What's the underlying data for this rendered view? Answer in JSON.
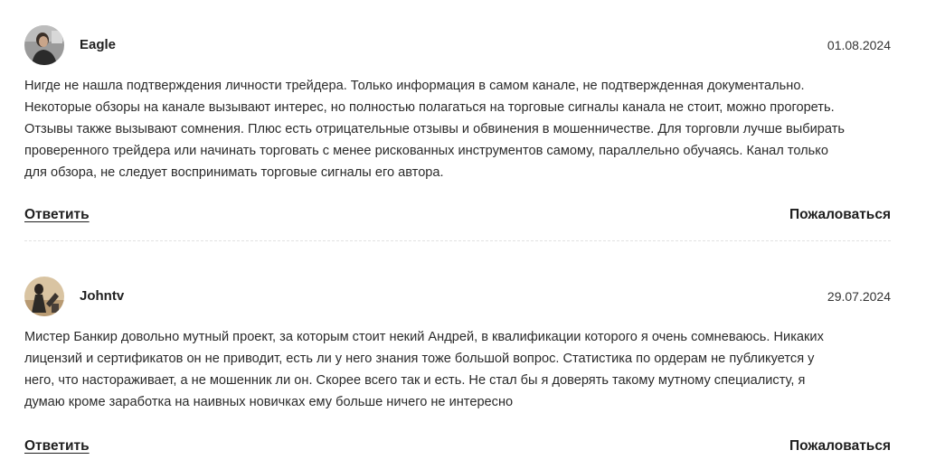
{
  "comments": [
    {
      "author": "Eagle",
      "date": "01.08.2024",
      "text_lines": [
        "Нигде не нашла подтверждения личности трейдера. Только информация в самом канале, не подтвержденная документально.",
        "Некоторые обзоры на канале вызывают интерес, но полностью полагаться на торговые сигналы канала не стоит, можно прогореть.",
        "Отзывы также вызывают сомнения. Плюс есть отрицательные отзывы и обвинения в мошенничестве. Для торговли лучше выбирать",
        "проверенного трейдера или начинать торговать с менее рискованных инструментов самому, параллельно обучаясь. Канал только",
        "для обзора, не следует воспринимать торговые сигналы его автора."
      ],
      "reply_label": "Ответить",
      "complain_label": "Пожаловаться"
    },
    {
      "author": "Johntv",
      "date": "29.07.2024",
      "text_lines": [
        "Мистер Банкир довольно мутный проект, за которым стоит некий Андрей, в квалификации которого я очень сомневаюсь. Никаких",
        "лицензий и сертификатов он не приводит, есть ли у него знания тоже большой вопрос. Статистика по ордерам не публикуется у",
        "него, что настораживает, а не мошенник ли он. Скорее всего так и есть. Не стал бы я доверять такому мутному специалисту, я",
        "думаю кроме заработка на наивных новичках ему больше ничего не интересно"
      ],
      "reply_label": "Ответить",
      "complain_label": "Пожаловаться"
    }
  ]
}
